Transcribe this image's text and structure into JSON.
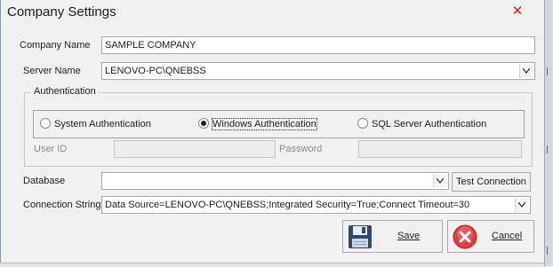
{
  "window": {
    "title": "Company Settings"
  },
  "company_name": {
    "label": "Company Name",
    "value": "SAMPLE COMPANY"
  },
  "server_name": {
    "label": "Server Name",
    "value": "LENOVO-PC\\QNEBSS"
  },
  "authentication": {
    "group_label": "Authentication",
    "options": [
      {
        "label": "System Authentication",
        "selected": false
      },
      {
        "label": "Windows Authentication",
        "selected": true
      },
      {
        "label": "SQL Server Authentication",
        "selected": false
      }
    ],
    "user_id_label": "User ID",
    "password_label": "Password",
    "user_id_value": "",
    "password_value": ""
  },
  "database": {
    "label": "Database",
    "value": "",
    "test_button": "Test Connection"
  },
  "connection_string": {
    "label": "Connection String",
    "value": "Data Source=LENOVO-PC\\QNEBSS;Integrated Security=True;Connect Timeout=30"
  },
  "buttons": {
    "save": "Save",
    "cancel": "Cancel"
  },
  "colors": {
    "cancel_icon": "#e03c3c",
    "save_icon": "#2f4a6e",
    "close_x": "#c42b1c"
  }
}
